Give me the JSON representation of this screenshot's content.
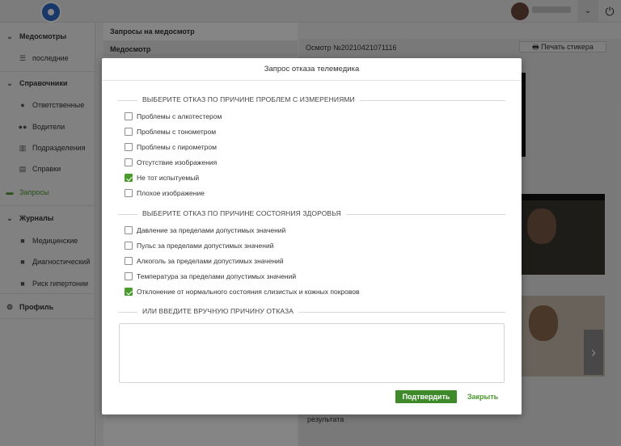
{
  "topbar": {
    "logo_icon": "app-logo-icon",
    "user_menu_icon": "chevron-down-icon",
    "power_icon": "power-icon"
  },
  "sidebar": {
    "items": [
      {
        "label": "Медосмотры",
        "icon": "chevron-down-icon",
        "type": "group"
      },
      {
        "label": "последние",
        "icon": "list-icon",
        "type": "item"
      },
      {
        "label": "Справочники",
        "icon": "chevron-down-icon",
        "type": "group"
      },
      {
        "label": "Ответственные",
        "icon": "user-icon",
        "type": "item"
      },
      {
        "label": "Водители",
        "icon": "users-icon",
        "type": "item"
      },
      {
        "label": "Подразделения",
        "icon": "building-icon",
        "type": "item"
      },
      {
        "label": "Справки",
        "icon": "document-icon",
        "type": "item"
      },
      {
        "label": "Запросы",
        "icon": "card-icon",
        "type": "active"
      },
      {
        "label": "Журналы",
        "icon": "chevron-down-icon",
        "type": "group"
      },
      {
        "label": "Медицинские",
        "icon": "journal-icon",
        "type": "item"
      },
      {
        "label": "Диагностический",
        "icon": "journal-icon",
        "type": "item"
      },
      {
        "label": "Риск гипертонии",
        "icon": "journal-icon",
        "type": "item"
      },
      {
        "label": "Профиль",
        "icon": "gear-icon",
        "type": "group"
      }
    ]
  },
  "list_panel": {
    "title": "Запросы на медосмотр",
    "column_header": "Медосмотр"
  },
  "right_panel": {
    "exam_number": "Осмотр №20210421071116",
    "print_button": "Печать стикера",
    "result_label": "результата"
  },
  "modal": {
    "title": "Запрос отказа телемедика",
    "section_measurements": "ВЫБЕРИТЕ ОТКАЗ ПО ПРИЧИНЕ ПРОБЛЕМ С ИЗМЕРЕНИЯМИ",
    "measurement_options": [
      {
        "label": "Проблемы с алкотестером",
        "checked": false
      },
      {
        "label": "Проблемы с тонометром",
        "checked": false
      },
      {
        "label": "Проблемы с пирометром",
        "checked": false
      },
      {
        "label": "Отсутствие изображения",
        "checked": false
      },
      {
        "label": "Не тот испытуемый",
        "checked": true
      },
      {
        "label": "Плохое изображение",
        "checked": false
      }
    ],
    "section_health": "ВЫБЕРИТЕ ОТКАЗ ПО ПРИЧИНЕ СОСТОЯНИЯ ЗДОРОВЬЯ",
    "health_options": [
      {
        "label": "Давление за пределами допустимых значений",
        "checked": false
      },
      {
        "label": "Пульс за пределами допустимых значений",
        "checked": false
      },
      {
        "label": "Алкоголь за пределами допустимых значений",
        "checked": false
      },
      {
        "label": "Температура за пределами допустимых значений",
        "checked": false
      },
      {
        "label": "Отклонение от нормального состояния слизистых и кожных покровов",
        "checked": true
      }
    ],
    "section_manual": "ИЛИ ВВЕДИТЕ ВРУЧНУЮ ПРИЧИНУ ОТКАЗА",
    "manual_reason_value": "",
    "confirm_button": "Подтвердить",
    "close_button": "Закрыть"
  },
  "colors": {
    "accent": "#4a9a2e",
    "confirm": "#3e8a2a"
  }
}
